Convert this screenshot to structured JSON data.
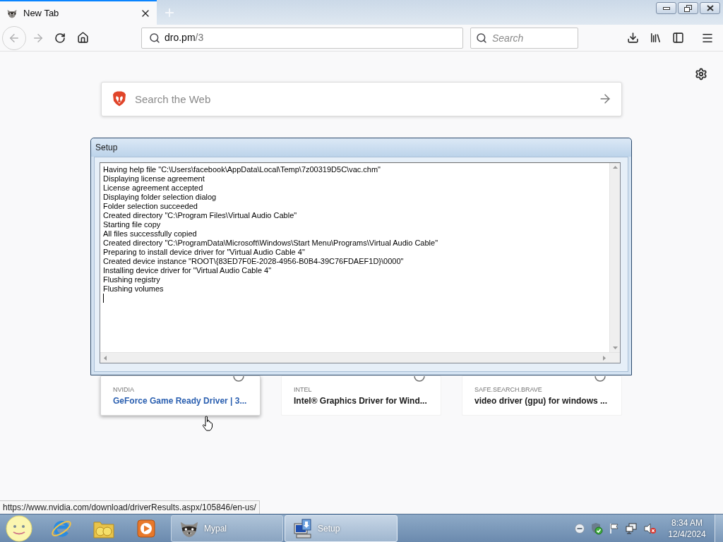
{
  "browser": {
    "tabs": [
      {
        "title": "New Tab",
        "selected": true
      }
    ],
    "address_bar": {
      "host": "dro.pm",
      "path": "/3"
    },
    "search_bar": {
      "placeholder": "Search"
    }
  },
  "new_tab_page": {
    "search": {
      "placeholder": "Search the Web"
    },
    "top_sites": [
      {
        "source": "NVIDIA",
        "title": "GeForce Game Ready Driver | 3...",
        "hovered": true
      },
      {
        "source": "INTEL",
        "title": "Intel® Graphics Driver for Wind...",
        "hovered": false
      },
      {
        "source": "SAFE.SEARCH.BRAVE",
        "title": "video driver (gpu) for windows ...",
        "hovered": false
      }
    ]
  },
  "dialog": {
    "title": "Setup",
    "log_lines": [
      "Having help file \"C:\\Users\\facebook\\AppData\\Local\\Temp\\7z00319D5C\\vac.chm\"",
      "Displaying license agreement",
      "License agreement accepted",
      "Displaying folder selection dialog",
      "Folder selection succeeded",
      "Created directory \"C:\\Program Files\\Virtual Audio Cable\"",
      "Starting file copy",
      "All files successfully copied",
      "Created directory \"C:\\ProgramData\\Microsoft\\Windows\\Start Menu\\Programs\\Virtual Audio Cable\"",
      "Preparing to install device driver for \"Virtual Audio Cable 4\"",
      "Created device instance \"ROOT\\{83ED7F0E-2028-4956-B0B4-39C76FDAEF1D}\\0000\"",
      "Installing device driver for \"Virtual Audio Cable 4\"",
      "Flushing registry",
      "Flushing volumes"
    ]
  },
  "status_url": "https://www.nvidia.com/download/driverResults.aspx/105846/en-us/",
  "taskbar": {
    "windows": [
      {
        "label": "Mypal",
        "kind": "browser",
        "selected": false
      },
      {
        "label": "Setup",
        "kind": "installer",
        "selected": true
      }
    ],
    "clock": {
      "time": "8:34 AM",
      "date": "12/4/2024"
    }
  }
}
